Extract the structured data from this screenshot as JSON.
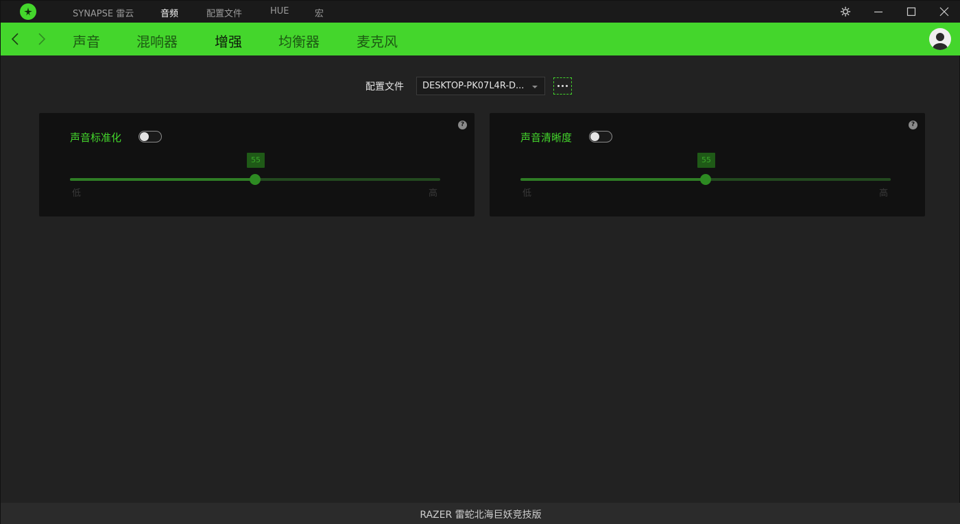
{
  "app": {
    "top_tabs": [
      {
        "label": "SYNAPSE 雷云",
        "active": false
      },
      {
        "label": "音频",
        "active": true
      },
      {
        "label": "配置文件",
        "active": false
      },
      {
        "label": "HUE",
        "active": false
      },
      {
        "label": "宏",
        "active": false
      }
    ],
    "window_controls": [
      "settings-icon",
      "minimize-icon",
      "maximize-icon",
      "close-icon"
    ]
  },
  "nav": {
    "sub_tabs": [
      {
        "label": "声音",
        "active": false
      },
      {
        "label": "混响器",
        "active": false
      },
      {
        "label": "增强",
        "active": true
      },
      {
        "label": "均衡器",
        "active": false
      },
      {
        "label": "麦克风",
        "active": false
      }
    ]
  },
  "profile": {
    "label": "配置文件",
    "selected": "DESKTOP-PK07L4R-D..."
  },
  "cards": [
    {
      "title": "声音标准化",
      "enabled": false,
      "help": "?",
      "slider": {
        "value": 55,
        "value_label": "55",
        "min": 0,
        "max": 100,
        "low_label": "低",
        "high_label": "高"
      }
    },
    {
      "title": "声音清晰度",
      "enabled": false,
      "help": "?",
      "slider": {
        "value": 55,
        "value_label": "55",
        "min": 0,
        "max": 100,
        "low_label": "低",
        "high_label": "高"
      }
    }
  ],
  "footer": {
    "text": "RAZER 雷蛇北海巨妖竞技版"
  },
  "colors": {
    "accent": "#44d62c",
    "background": "#222222",
    "card": "#111111",
    "titlebar": "#1a1a1a"
  }
}
